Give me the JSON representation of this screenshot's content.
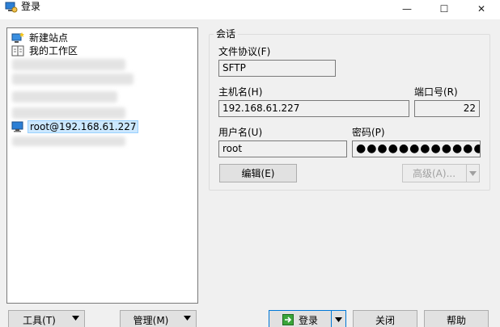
{
  "window": {
    "title": "登录",
    "min_glyph": "—",
    "max_glyph": "☐",
    "close_glyph": "✕"
  },
  "sites": {
    "items": [
      {
        "label": "新建站点",
        "icon": "new-site-icon"
      },
      {
        "label": "我的工作区",
        "icon": "workspace-icon"
      },
      {
        "label": "root@192.168.61.227",
        "icon": "computer-icon",
        "selected": true
      }
    ]
  },
  "session": {
    "group_title": "会话",
    "protocol_label": "文件协议(F)",
    "protocol_value": "SFTP",
    "host_label": "主机名(H)",
    "host_value": "192.168.61.227",
    "port_label": "端口号(R)",
    "port_value": "22",
    "user_label": "用户名(U)",
    "user_value": "root",
    "password_label": "密码(P)",
    "password_value": "●●●●●●●●●●●●●●●●",
    "edit_button": "编辑(E)",
    "advanced_button": "高级(A)..."
  },
  "footer": {
    "tools_button": "工具(T)",
    "manage_button": "管理(M)",
    "login_button": "登录",
    "close_button": "关闭",
    "help_button": "帮助"
  },
  "colors": {
    "accent": "#0078d7",
    "selection": "#cce8ff",
    "window_bg": "#f0f0f0"
  }
}
